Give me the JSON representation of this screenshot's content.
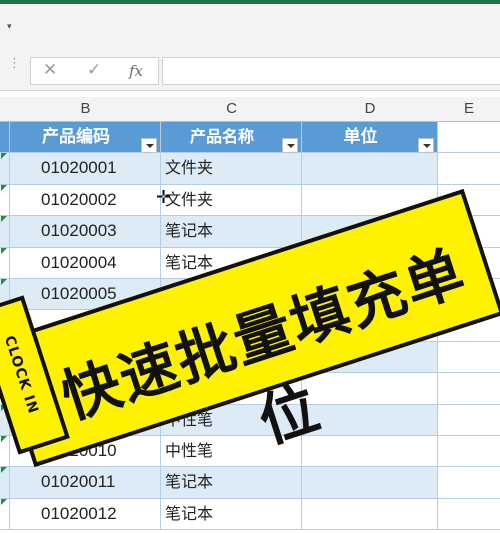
{
  "toolbar": {
    "caret": "▾"
  },
  "formula_bar": {
    "grip": "⋮",
    "cancel_icon": "✕",
    "enter_icon": "✓",
    "fx_label": "fx",
    "value": ""
  },
  "columns": [
    "B",
    "C",
    "D",
    "E"
  ],
  "table": {
    "headers": {
      "code": "产品编码",
      "name": "产品名称",
      "unit": "单位"
    },
    "rows": [
      {
        "code": "01020001",
        "name": "文件夹",
        "unit": ""
      },
      {
        "code": "01020002",
        "name": "文件夹",
        "unit": ""
      },
      {
        "code": "01020003",
        "name": "笔记本",
        "unit": ""
      },
      {
        "code": "01020004",
        "name": "笔记本",
        "unit": ""
      },
      {
        "code": "01020005",
        "name": "",
        "unit": ""
      },
      {
        "code": "",
        "name": "",
        "unit": ""
      },
      {
        "code": "",
        "name": "",
        "unit": ""
      },
      {
        "code": "",
        "name": "",
        "unit": ""
      },
      {
        "code": "",
        "name": "中性笔",
        "unit": ""
      },
      {
        "code": "01020010",
        "name": "中性笔",
        "unit": ""
      },
      {
        "code": "01020011",
        "name": "笔记本",
        "unit": ""
      },
      {
        "code": "01020012",
        "name": "笔记本",
        "unit": ""
      }
    ]
  },
  "overlay": {
    "title": "快速批量填充单位",
    "stamp": "CLOCK IN"
  },
  "colors": {
    "header_blue": "#5b9bd5",
    "band_blue": "#ddebf7",
    "banner_yellow": "#fff200",
    "excel_green": "#217346"
  }
}
